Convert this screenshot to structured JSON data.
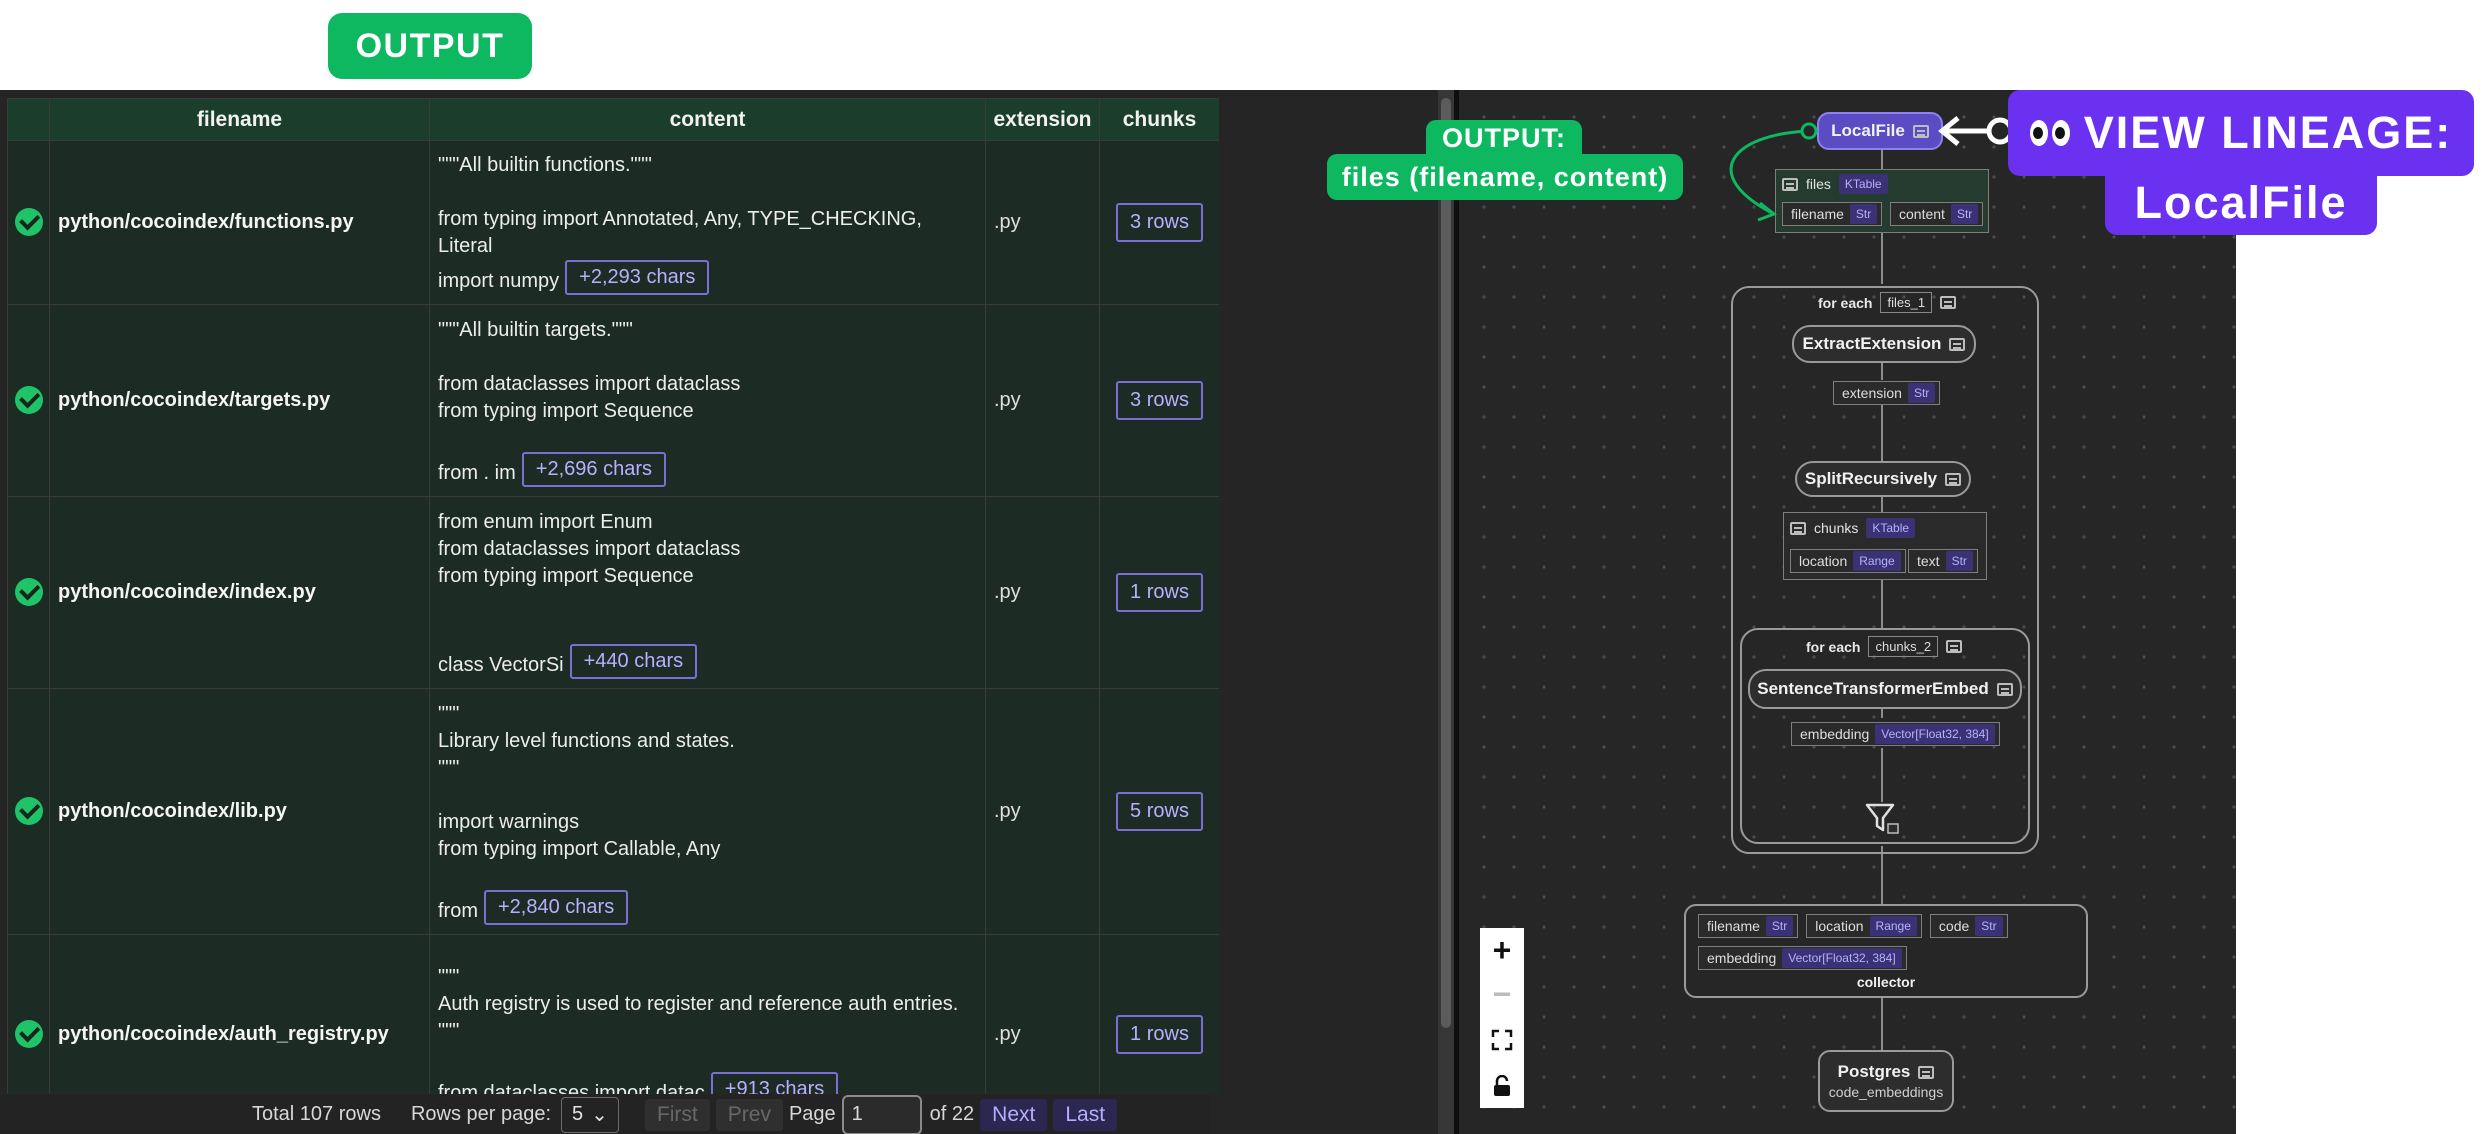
{
  "banner": {
    "output_label": "OUTPUT"
  },
  "table": {
    "columns": [
      "",
      "filename",
      "content",
      "extension",
      "chunks"
    ],
    "rows": [
      {
        "filename": "python/cocoindex/functions.py",
        "content": "\"\"\"All builtin functions.\"\"\"\n\nfrom typing import Annotated, Any, TYPE_CHECKING, Literal\nimport numpy",
        "more": "+2,293 chars",
        "extension": ".py",
        "chunks": "3 rows"
      },
      {
        "filename": "python/cocoindex/targets.py",
        "content": "\"\"\"All builtin targets.\"\"\"\n\nfrom dataclasses import dataclass\nfrom typing import Sequence\n\nfrom . im",
        "more": "+2,696 chars",
        "extension": ".py",
        "chunks": "3 rows"
      },
      {
        "filename": "python/cocoindex/index.py",
        "content": "from enum import Enum\nfrom dataclasses import dataclass\nfrom typing import Sequence\n\n\nclass VectorSi",
        "more": "+440 chars",
        "extension": ".py",
        "chunks": "1 rows"
      },
      {
        "filename": "python/cocoindex/lib.py",
        "content": "\"\"\"\nLibrary level functions and states.\n\"\"\"\n\nimport warnings\nfrom typing import Callable, Any\n\nfrom",
        "more": "+2,840 chars",
        "extension": ".py",
        "chunks": "5 rows"
      },
      {
        "filename": "python/cocoindex/auth_registry.py",
        "content": "\"\"\"\nAuth registry is used to register and reference auth entries.\n\"\"\"\n\nfrom dataclasses import datac",
        "more": "+913 chars",
        "extension": ".py",
        "chunks": "1 rows"
      }
    ]
  },
  "pagination": {
    "total": "Total 107 rows",
    "rows_per_page_label": "Rows per page:",
    "rows_per_page_value": "5",
    "first": "First",
    "prev": "Prev",
    "page_label": "Page",
    "page_value": "1",
    "of_label": "of 22",
    "next": "Next",
    "last": "Last"
  },
  "lineage": {
    "source_node": "LocalFile",
    "files_label": "files",
    "files_type": "KTable",
    "filename_field": "filename",
    "filename_type": "Str",
    "content_field": "content",
    "content_type": "Str",
    "foreach1_label": "for each",
    "foreach1_tag": "files_1",
    "extract_node": "ExtractExtension",
    "extension_field": "extension",
    "extension_type": "Str",
    "split_node": "SplitRecursively",
    "chunks_label": "chunks",
    "chunks_type": "KTable",
    "location_field": "location",
    "location_type": "Range",
    "text_field": "text",
    "text_type": "Str",
    "foreach2_label": "for each",
    "foreach2_tag": "chunks_2",
    "embed_node": "SentenceTransformerEmbed",
    "embedding_field": "embedding",
    "embedding_type": "Vector[Float32, 384]",
    "collector_fields": [
      {
        "name": "filename",
        "type": "Str"
      },
      {
        "name": "location",
        "type": "Range"
      },
      {
        "name": "code",
        "type": "Str"
      },
      {
        "name": "embedding",
        "type": "Vector[Float32, 384]"
      }
    ],
    "collector_label": "collector",
    "target_node": "Postgres",
    "target_sub": "code_embeddings"
  },
  "annotations": {
    "output_line1": "OUTPUT:",
    "output_line2": "files (filename, content)",
    "lineage_line1": "VIEW LINEAGE:",
    "lineage_line2": "LocalFile"
  },
  "colors": {
    "accent_green": "#0db861",
    "accent_purple": "#6a31f0",
    "chip_purple": "#3b3276"
  }
}
